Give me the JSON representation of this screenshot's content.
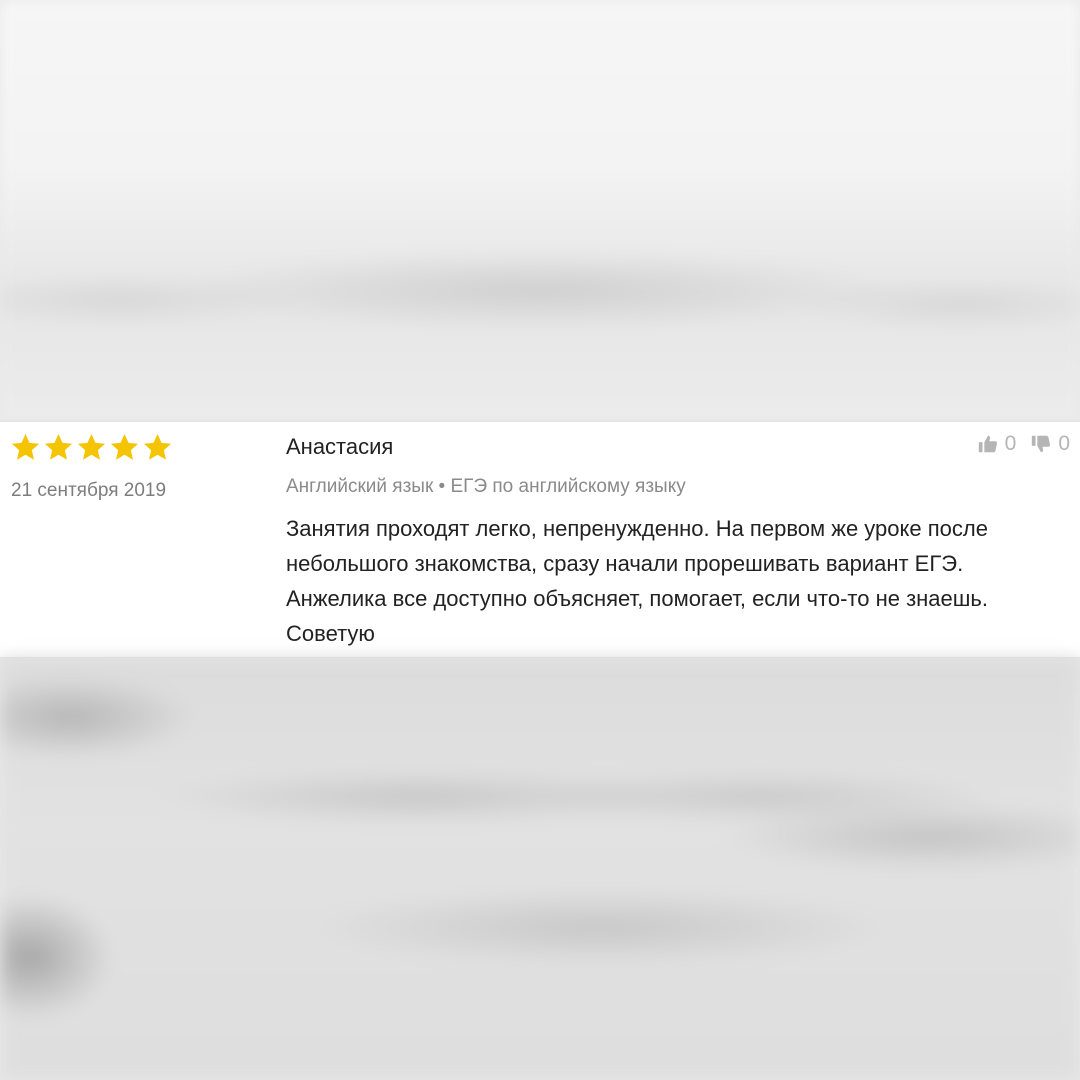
{
  "review": {
    "rating": 5,
    "rating_max": 5,
    "star_color": "#f5c400",
    "date": "21 сентября 2019",
    "author": "Анастасия",
    "subject": "Английский язык • ЕГЭ по английскому языку",
    "text": "Занятия проходят легко, непренужденно. На первом же уроке после небольшого знакомства, сразу начали прорешивать вариант ЕГЭ. Анжелика все доступно объясняет, помогает, если что-то не знаешь. Советую",
    "likes": "0",
    "dislikes": "0",
    "icons": {
      "like": "thumbs-up-icon",
      "dislike": "thumbs-down-icon",
      "star": "star-icon"
    }
  }
}
